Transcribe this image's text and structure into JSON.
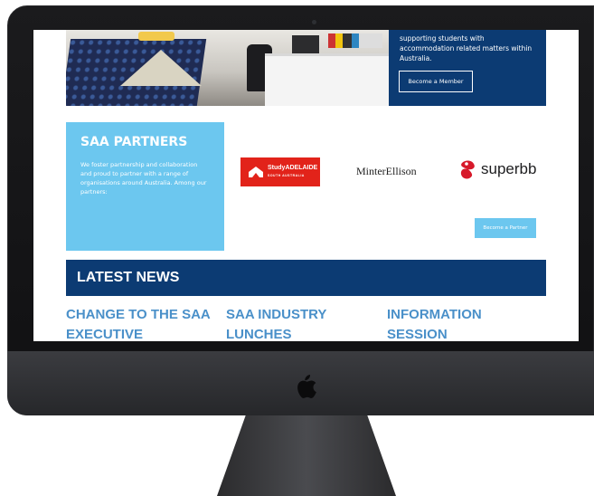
{
  "hero": {
    "text": "supporting students with accommodation related matters within Australia.",
    "member_button": "Become a Member"
  },
  "partners": {
    "title": "SAA PARTNERS",
    "description": "We foster partnership and collaboration and proud to partner with a range of organisations around Australia. Among our partners:",
    "logos": {
      "study_adelaide": {
        "name": "StudyADELAIDE",
        "sub": "SOUTH AUSTRALIA"
      },
      "minter_ellison": "MinterEllison",
      "superbb": "superbb"
    },
    "partner_button": "Become a Partner"
  },
  "news": {
    "heading": "LATEST NEWS",
    "items": [
      "CHANGE TO THE SAA EXECUTIVE",
      "SAA INDUSTRY LUNCHES",
      "INFORMATION SESSION"
    ]
  },
  "colors": {
    "navy": "#0c3b73",
    "light_blue": "#6cc7ef",
    "news_link": "#4a90c9",
    "study_red": "#e2231a",
    "superbb_red": "#d7192a"
  }
}
